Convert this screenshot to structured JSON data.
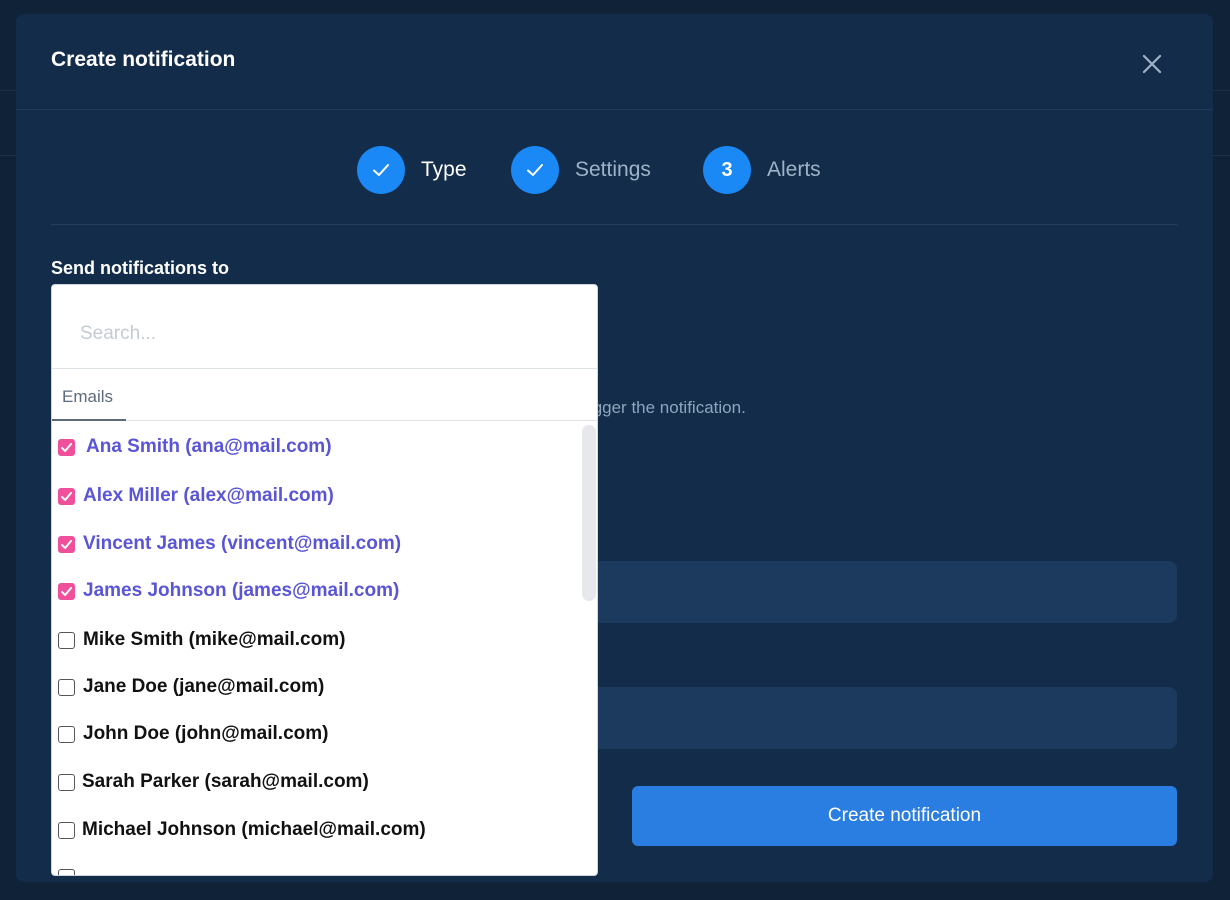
{
  "modal": {
    "title": "Create notification",
    "close_icon": "close-icon"
  },
  "stepper": {
    "steps": [
      {
        "label": "Type",
        "state": "done",
        "icon": "check-icon"
      },
      {
        "label": "Settings",
        "state": "done",
        "icon": "check-icon"
      },
      {
        "label": "Alerts",
        "state": "current",
        "number": "3"
      }
    ]
  },
  "form": {
    "recipients_label": "Send notifications to",
    "helper_text_fragment": "ne to trigger the notification.",
    "submit_label": "Create notification"
  },
  "dropdown": {
    "search_placeholder": "Search...",
    "search_value": "",
    "tab_label": "Emails",
    "items": [
      {
        "label": "Ana Smith (ana@mail.com)",
        "checked": true
      },
      {
        "label": "Alex Miller (alex@mail.com)",
        "checked": true
      },
      {
        "label": "Vincent James (vincent@mail.com)",
        "checked": true
      },
      {
        "label": "James Johnson (james@mail.com)",
        "checked": true
      },
      {
        "label": "Mike Smith (mike@mail.com)",
        "checked": false
      },
      {
        "label": "Jane Doe (jane@mail.com)",
        "checked": false
      },
      {
        "label": "John Doe (john@mail.com)",
        "checked": false
      },
      {
        "label": "Sarah Parker (sarah@mail.com)",
        "checked": false
      },
      {
        "label": "Michael Johnson (michael@mail.com)",
        "checked": false
      }
    ]
  },
  "colors": {
    "page_bg": "#0f2238",
    "modal_bg": "#132c4a",
    "accent_blue": "#1a88f5",
    "button_blue": "#2a7de1",
    "checkbox_pink": "#ef4f9b",
    "selected_text": "#5a55d6"
  }
}
